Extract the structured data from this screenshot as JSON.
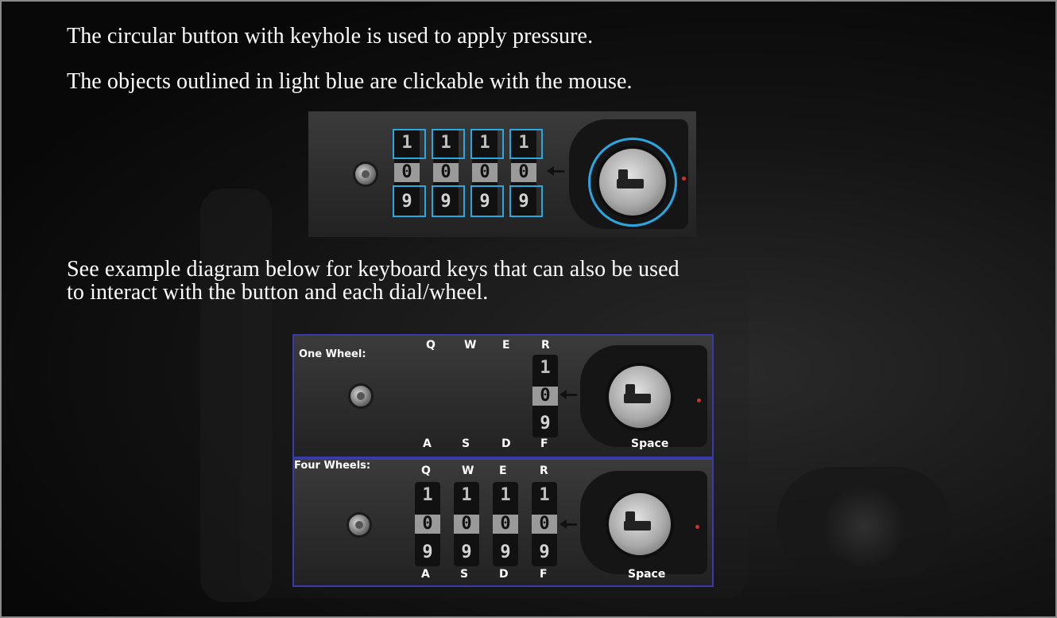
{
  "instructions": {
    "line1": "The circular button with keyhole is used to apply pressure.",
    "line2": "The objects outlined in light blue are clickable with the mouse.",
    "line3": "See example diagram below for keyboard keys that can also be used",
    "line4": "to interact with the button and each dial/wheel."
  },
  "top_lock": {
    "wheels": [
      {
        "top": "1",
        "mid": "0",
        "bottom": "9"
      },
      {
        "top": "1",
        "mid": "0",
        "bottom": "9"
      },
      {
        "top": "1",
        "mid": "0",
        "bottom": "9"
      },
      {
        "top": "1",
        "mid": "0",
        "bottom": "9"
      }
    ],
    "outline_color": "#2aa6e0"
  },
  "one_wheel_diagram": {
    "caption": "One Wheel:",
    "keys_top": [
      "Q",
      "W",
      "E",
      "R"
    ],
    "keys_bottom": [
      "A",
      "S",
      "D",
      "F"
    ],
    "button_key": "Space",
    "wheel": {
      "top": "1",
      "mid": "0",
      "bottom": "9"
    }
  },
  "four_wheel_diagram": {
    "caption": "Four Wheels:",
    "keys_top": [
      "Q",
      "W",
      "E",
      "R"
    ],
    "keys_bottom": [
      "A",
      "S",
      "D",
      "F"
    ],
    "button_key": "Space",
    "wheels": [
      {
        "top": "1",
        "mid": "0",
        "bottom": "9"
      },
      {
        "top": "1",
        "mid": "0",
        "bottom": "9"
      },
      {
        "top": "1",
        "mid": "0",
        "bottom": "9"
      },
      {
        "top": "1",
        "mid": "0",
        "bottom": "9"
      }
    ]
  },
  "colors": {
    "clickable_outline": "#2aa6e0",
    "diagram_border": "#3a3aa8"
  }
}
